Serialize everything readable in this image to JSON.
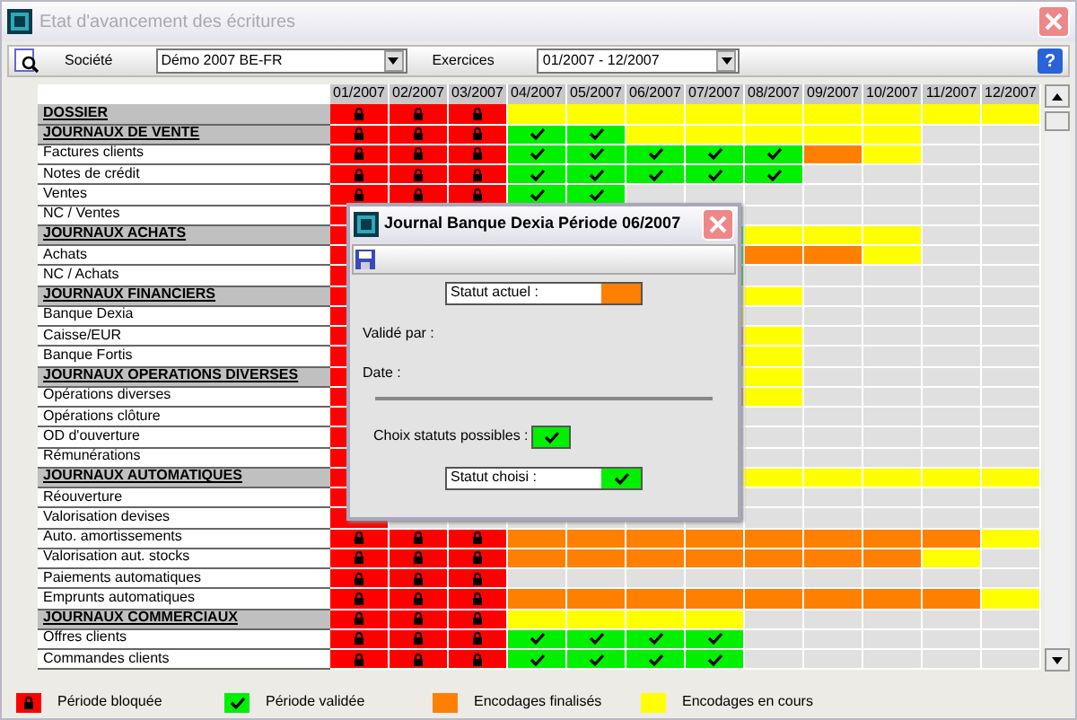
{
  "window": {
    "title": "Etat d'avancement des écritures"
  },
  "toolbar": {
    "company_label": "Société",
    "company_value": "Démo 2007 BE-FR",
    "period_label": "Exercices",
    "period_value": "01/2007 - 12/2007",
    "help": "?"
  },
  "grid": {
    "columns": [
      "01/2007",
      "02/2007",
      "03/2007",
      "04/2007",
      "05/2007",
      "06/2007",
      "07/2007",
      "08/2007",
      "09/2007",
      "10/2007",
      "11/2007",
      "12/2007"
    ],
    "rows": [
      {
        "label": "DOSSIER",
        "kind": "section",
        "cells": [
          {
            "kind": "locked"
          },
          {
            "kind": "locked"
          },
          {
            "kind": "locked"
          },
          {
            "kind": "open"
          },
          {
            "kind": "open"
          },
          {
            "kind": "open"
          },
          {
            "kind": "open"
          },
          {
            "kind": "open"
          },
          {
            "kind": "open"
          },
          {
            "kind": "open"
          },
          {
            "kind": "open"
          },
          {
            "kind": "open"
          }
        ]
      },
      {
        "label": "JOURNAUX DE VENTE",
        "kind": "section",
        "cells": [
          {
            "kind": "locked"
          },
          {
            "kind": "locked"
          },
          {
            "kind": "locked"
          },
          {
            "kind": "valid"
          },
          {
            "kind": "valid"
          },
          {
            "kind": "open"
          },
          {
            "kind": "open"
          },
          {
            "kind": "open"
          },
          {
            "kind": "open"
          },
          {
            "kind": "open"
          },
          {
            "kind": "none"
          },
          {
            "kind": "none"
          }
        ]
      },
      {
        "label": "Factures clients",
        "kind": "item",
        "cells": [
          {
            "kind": "locked"
          },
          {
            "kind": "locked"
          },
          {
            "kind": "locked"
          },
          {
            "kind": "valid"
          },
          {
            "kind": "valid"
          },
          {
            "kind": "valid"
          },
          {
            "kind": "valid"
          },
          {
            "kind": "valid"
          },
          {
            "kind": "final"
          },
          {
            "kind": "open"
          },
          {
            "kind": "none"
          },
          {
            "kind": "none"
          }
        ]
      },
      {
        "label": "Notes de crédit",
        "kind": "item",
        "cells": [
          {
            "kind": "locked"
          },
          {
            "kind": "locked"
          },
          {
            "kind": "locked"
          },
          {
            "kind": "valid"
          },
          {
            "kind": "valid"
          },
          {
            "kind": "valid"
          },
          {
            "kind": "valid"
          },
          {
            "kind": "valid"
          },
          {
            "kind": "none"
          },
          {
            "kind": "none"
          },
          {
            "kind": "none"
          },
          {
            "kind": "none"
          }
        ]
      },
      {
        "label": "Ventes",
        "kind": "item",
        "cells": [
          {
            "kind": "locked"
          },
          {
            "kind": "locked"
          },
          {
            "kind": "locked"
          },
          {
            "kind": "valid"
          },
          {
            "kind": "valid"
          },
          {
            "kind": "none"
          },
          {
            "kind": "none"
          },
          {
            "kind": "none"
          },
          {
            "kind": "none"
          },
          {
            "kind": "none"
          },
          {
            "kind": "none"
          },
          {
            "kind": "none"
          }
        ]
      },
      {
        "label": "NC / Ventes",
        "kind": "item",
        "cells": [
          {
            "kind": "locked"
          },
          null,
          null,
          null,
          null,
          null,
          {
            "kind": "none"
          },
          {
            "kind": "none"
          },
          {
            "kind": "none"
          },
          {
            "kind": "none"
          },
          {
            "kind": "none"
          },
          {
            "kind": "none"
          }
        ]
      },
      {
        "label": "JOURNAUX ACHATS",
        "kind": "section",
        "cells": [
          {
            "kind": "locked"
          },
          null,
          null,
          null,
          null,
          null,
          {
            "kind": "valid"
          },
          {
            "kind": "open"
          },
          {
            "kind": "open"
          },
          {
            "kind": "open"
          },
          {
            "kind": "none"
          },
          {
            "kind": "none"
          }
        ]
      },
      {
        "label": "Achats",
        "kind": "item",
        "cells": [
          {
            "kind": "locked"
          },
          null,
          null,
          null,
          null,
          null,
          {
            "kind": "valid"
          },
          {
            "kind": "final"
          },
          {
            "kind": "final"
          },
          {
            "kind": "open"
          },
          {
            "kind": "none"
          },
          {
            "kind": "none"
          }
        ]
      },
      {
        "label": "NC / Achats",
        "kind": "item",
        "cells": [
          {
            "kind": "locked"
          },
          null,
          null,
          null,
          null,
          null,
          {
            "kind": "valid"
          },
          {
            "kind": "none"
          },
          {
            "kind": "none"
          },
          {
            "kind": "none"
          },
          {
            "kind": "none"
          },
          {
            "kind": "none"
          }
        ]
      },
      {
        "label": "JOURNAUX FINANCIERS",
        "kind": "section",
        "cells": [
          {
            "kind": "locked"
          },
          null,
          null,
          null,
          null,
          null,
          {
            "kind": "open"
          },
          {
            "kind": "open"
          },
          {
            "kind": "none"
          },
          {
            "kind": "none"
          },
          {
            "kind": "none"
          },
          {
            "kind": "none"
          }
        ]
      },
      {
        "label": "Banque Dexia",
        "kind": "item",
        "cells": [
          {
            "kind": "locked"
          },
          null,
          null,
          null,
          null,
          null,
          {
            "kind": "open"
          },
          {
            "kind": "none"
          },
          {
            "kind": "none"
          },
          {
            "kind": "none"
          },
          {
            "kind": "none"
          },
          {
            "kind": "none"
          }
        ]
      },
      {
        "label": "Caisse/EUR",
        "kind": "item",
        "cells": [
          {
            "kind": "locked"
          },
          null,
          null,
          null,
          null,
          null,
          {
            "kind": "final"
          },
          {
            "kind": "open"
          },
          {
            "kind": "none"
          },
          {
            "kind": "none"
          },
          {
            "kind": "none"
          },
          {
            "kind": "none"
          }
        ]
      },
      {
        "label": "Banque Fortis",
        "kind": "item",
        "cells": [
          {
            "kind": "locked"
          },
          null,
          null,
          null,
          null,
          null,
          {
            "kind": "final"
          },
          {
            "kind": "open"
          },
          {
            "kind": "none"
          },
          {
            "kind": "none"
          },
          {
            "kind": "none"
          },
          {
            "kind": "none"
          }
        ]
      },
      {
        "label": "JOURNAUX OPERATIONS DIVERSES",
        "kind": "section",
        "cells": [
          {
            "kind": "locked"
          },
          null,
          null,
          null,
          null,
          null,
          {
            "kind": "open"
          },
          {
            "kind": "open"
          },
          {
            "kind": "none"
          },
          {
            "kind": "none"
          },
          {
            "kind": "none"
          },
          {
            "kind": "none"
          }
        ]
      },
      {
        "label": "Opérations diverses",
        "kind": "item",
        "cells": [
          {
            "kind": "locked"
          },
          null,
          null,
          null,
          null,
          null,
          {
            "kind": "final"
          },
          {
            "kind": "open"
          },
          {
            "kind": "none"
          },
          {
            "kind": "none"
          },
          {
            "kind": "none"
          },
          {
            "kind": "none"
          }
        ]
      },
      {
        "label": "Opérations clôture",
        "kind": "item",
        "cells": [
          {
            "kind": "locked"
          },
          null,
          null,
          null,
          null,
          null,
          {
            "kind": "none"
          },
          {
            "kind": "none"
          },
          {
            "kind": "none"
          },
          {
            "kind": "none"
          },
          {
            "kind": "none"
          },
          {
            "kind": "none"
          }
        ]
      },
      {
        "label": "OD d'ouverture",
        "kind": "item",
        "cells": [
          {
            "kind": "locked"
          },
          null,
          null,
          null,
          null,
          null,
          {
            "kind": "none"
          },
          {
            "kind": "none"
          },
          {
            "kind": "none"
          },
          {
            "kind": "none"
          },
          {
            "kind": "none"
          },
          {
            "kind": "none"
          }
        ]
      },
      {
        "label": "Rémunérations",
        "kind": "item",
        "cells": [
          {
            "kind": "locked"
          },
          null,
          null,
          null,
          null,
          null,
          {
            "kind": "none"
          },
          {
            "kind": "none"
          },
          {
            "kind": "none"
          },
          {
            "kind": "none"
          },
          {
            "kind": "none"
          },
          {
            "kind": "none"
          }
        ]
      },
      {
        "label": "JOURNAUX AUTOMATIQUES",
        "kind": "section",
        "cells": [
          {
            "kind": "locked"
          },
          null,
          null,
          null,
          null,
          null,
          {
            "kind": "open"
          },
          {
            "kind": "open"
          },
          {
            "kind": "open"
          },
          {
            "kind": "open"
          },
          {
            "kind": "open"
          },
          {
            "kind": "open"
          }
        ]
      },
      {
        "label": "Réouverture",
        "kind": "item",
        "cells": [
          {
            "kind": "locked"
          },
          null,
          null,
          null,
          null,
          null,
          {
            "kind": "none"
          },
          {
            "kind": "none"
          },
          {
            "kind": "none"
          },
          {
            "kind": "none"
          },
          {
            "kind": "none"
          },
          {
            "kind": "none"
          }
        ]
      },
      {
        "label": "Valorisation devises",
        "kind": "item",
        "cells": [
          {
            "kind": "locked"
          },
          null,
          null,
          null,
          null,
          null,
          {
            "kind": "none"
          },
          {
            "kind": "none"
          },
          {
            "kind": "none"
          },
          {
            "kind": "none"
          },
          {
            "kind": "none"
          },
          {
            "kind": "none"
          }
        ]
      },
      {
        "label": "Auto. amortissements",
        "kind": "item",
        "cells": [
          {
            "kind": "locked"
          },
          {
            "kind": "locked"
          },
          {
            "kind": "locked"
          },
          {
            "kind": "final"
          },
          {
            "kind": "final"
          },
          {
            "kind": "final"
          },
          {
            "kind": "final"
          },
          {
            "kind": "final"
          },
          {
            "kind": "final"
          },
          {
            "kind": "final"
          },
          {
            "kind": "final"
          },
          {
            "kind": "open"
          }
        ]
      },
      {
        "label": "Valorisation aut. stocks",
        "kind": "item",
        "cells": [
          {
            "kind": "locked"
          },
          {
            "kind": "locked"
          },
          {
            "kind": "locked"
          },
          {
            "kind": "final"
          },
          {
            "kind": "final"
          },
          {
            "kind": "final"
          },
          {
            "kind": "final"
          },
          {
            "kind": "final"
          },
          {
            "kind": "final"
          },
          {
            "kind": "final"
          },
          {
            "kind": "open"
          },
          {
            "kind": "none"
          }
        ]
      },
      {
        "label": "Paiements automatiques",
        "kind": "item",
        "cells": [
          {
            "kind": "locked"
          },
          {
            "kind": "locked"
          },
          {
            "kind": "locked"
          },
          {
            "kind": "none"
          },
          {
            "kind": "none"
          },
          {
            "kind": "none"
          },
          {
            "kind": "none"
          },
          {
            "kind": "none"
          },
          {
            "kind": "none"
          },
          {
            "kind": "none"
          },
          {
            "kind": "none"
          },
          {
            "kind": "none"
          }
        ]
      },
      {
        "label": "Emprunts automatiques",
        "kind": "item",
        "cells": [
          {
            "kind": "locked"
          },
          {
            "kind": "locked"
          },
          {
            "kind": "locked"
          },
          {
            "kind": "final"
          },
          {
            "kind": "final"
          },
          {
            "kind": "final"
          },
          {
            "kind": "final"
          },
          {
            "kind": "final"
          },
          {
            "kind": "final"
          },
          {
            "kind": "final"
          },
          {
            "kind": "final"
          },
          {
            "kind": "open"
          }
        ]
      },
      {
        "label": "JOURNAUX COMMERCIAUX",
        "kind": "section",
        "cells": [
          {
            "kind": "locked"
          },
          {
            "kind": "locked"
          },
          {
            "kind": "locked"
          },
          {
            "kind": "open"
          },
          {
            "kind": "open"
          },
          {
            "kind": "open"
          },
          {
            "kind": "open"
          },
          {
            "kind": "none"
          },
          {
            "kind": "none"
          },
          {
            "kind": "none"
          },
          {
            "kind": "none"
          },
          {
            "kind": "none"
          }
        ]
      },
      {
        "label": "Offres clients",
        "kind": "item",
        "cells": [
          {
            "kind": "locked"
          },
          {
            "kind": "locked"
          },
          {
            "kind": "locked"
          },
          {
            "kind": "valid"
          },
          {
            "kind": "valid"
          },
          {
            "kind": "valid"
          },
          {
            "kind": "valid"
          },
          {
            "kind": "none"
          },
          {
            "kind": "none"
          },
          {
            "kind": "none"
          },
          {
            "kind": "none"
          },
          {
            "kind": "none"
          }
        ]
      },
      {
        "label": "Commandes clients",
        "kind": "item",
        "cells": [
          {
            "kind": "locked"
          },
          {
            "kind": "locked"
          },
          {
            "kind": "locked"
          },
          {
            "kind": "valid"
          },
          {
            "kind": "valid"
          },
          {
            "kind": "valid"
          },
          {
            "kind": "valid"
          },
          {
            "kind": "none"
          },
          {
            "kind": "none"
          },
          {
            "kind": "none"
          },
          {
            "kind": "none"
          },
          {
            "kind": "none"
          }
        ]
      }
    ]
  },
  "dialog": {
    "title": "Journal Banque Dexia Période 06/2007",
    "current_label": "Statut actuel :",
    "current_status": {
      "kind": "final"
    },
    "validated_by_label": "Validé par :",
    "date_label": "Date :",
    "choices_label": "Choix statuts possibles :",
    "choices": [
      {
        "kind": "valid"
      }
    ],
    "chosen_label": "Statut choisi :",
    "chosen_status": {
      "kind": "valid"
    }
  },
  "legend": [
    {
      "kind": "locked",
      "label": "Période bloquée"
    },
    {
      "kind": "valid",
      "label": "Période validée"
    },
    {
      "kind": "final",
      "label": "Encodages finalisés"
    },
    {
      "kind": "open",
      "label": "Encodages en cours"
    }
  ]
}
